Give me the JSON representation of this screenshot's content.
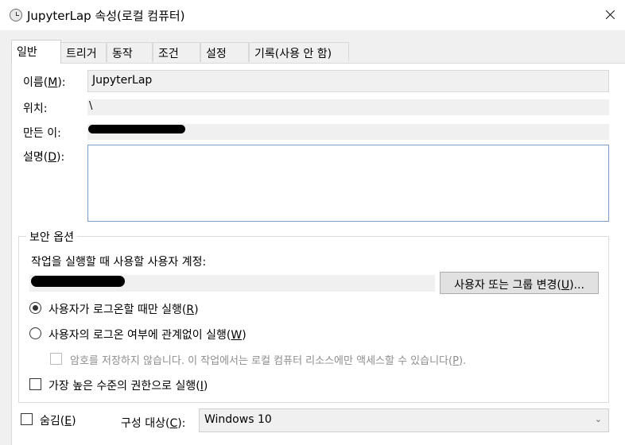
{
  "window": {
    "title": "JupyterLap 속성(로컬 컴퓨터)"
  },
  "tabs": [
    {
      "label": "일반"
    },
    {
      "label": "트리거"
    },
    {
      "label": "동작"
    },
    {
      "label": "조건"
    },
    {
      "label": "설정"
    },
    {
      "label": "기록(사용 안 함)"
    }
  ],
  "general": {
    "name": {
      "label": "이름(",
      "key": "M",
      "suffix": "):",
      "value": "JupyterLap"
    },
    "location": {
      "label": "위치:",
      "value": "\\"
    },
    "author": {
      "label": "만든 이:"
    },
    "description": {
      "label": "설명(",
      "key": "D",
      "suffix": "):",
      "value": ""
    }
  },
  "security": {
    "title": "보안 옵션",
    "account_label": "작업을 실행할 때 사용할 사용자 계정:",
    "change_button": {
      "label": "사용자 또는 그룹 변경(",
      "key": "U",
      "suffix": ")..."
    },
    "radio_logged_on": {
      "label": "사용자가 로그온할 때만 실행(",
      "key": "R",
      "suffix": ")",
      "checked": true
    },
    "radio_whether": {
      "label": "사용자의 로그온 여부에 관계없이 실행(",
      "key": "W",
      "suffix": ")",
      "checked": false
    },
    "no_store_password": {
      "label": "암호를 저장하지 않습니다. 이 작업에서는 로컬 컴퓨터 리소스에만 액세스할 수 있습니다(",
      "key": "P",
      "suffix": ").",
      "checked": false,
      "enabled": false
    },
    "highest_privileges": {
      "label": "가장 높은 수준의 권한으로 실행(",
      "key": "I",
      "suffix": ")",
      "checked": false
    }
  },
  "footer": {
    "hidden": {
      "label": "숨김(",
      "key": "E",
      "suffix": ")",
      "checked": false
    },
    "configure_for": {
      "label": "구성 대상(",
      "key": "C",
      "suffix": "):",
      "value": "Windows 10"
    }
  }
}
